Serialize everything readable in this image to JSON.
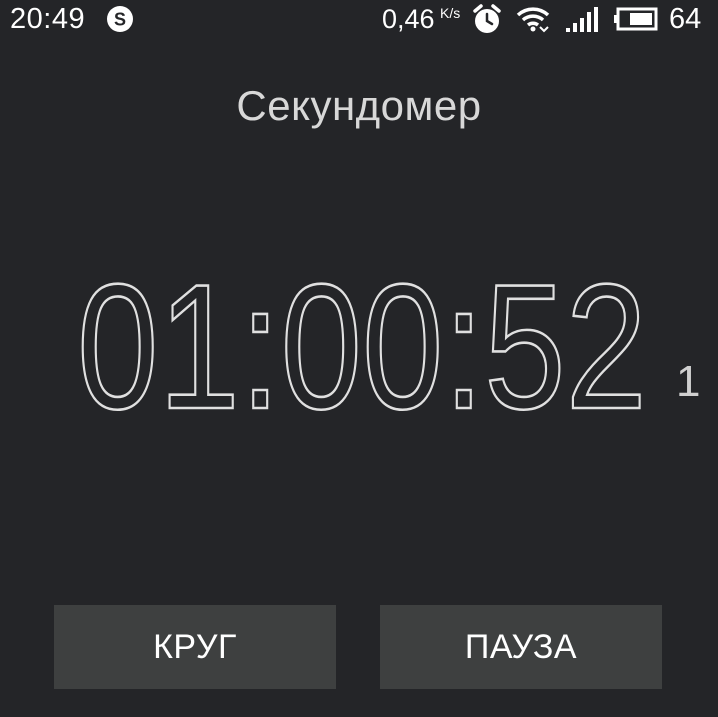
{
  "status_bar": {
    "time": "20:49",
    "notification_icon": "skype-icon",
    "net_speed": "0,46",
    "net_speed_unit": "K/s",
    "icons": [
      "alarm-clock-icon",
      "wifi-icon",
      "signal-icon",
      "battery-icon"
    ],
    "battery_percent": "64"
  },
  "screen": {
    "title": "Секундомер"
  },
  "stopwatch": {
    "display": "01:00:52",
    "hundredths": "1"
  },
  "buttons": {
    "lap_label": "КРУГ",
    "pause_label": "ПАУЗА"
  },
  "colors": {
    "background": "#242528",
    "button": "#3e4040",
    "timer_digits": "#e0e0e0"
  }
}
